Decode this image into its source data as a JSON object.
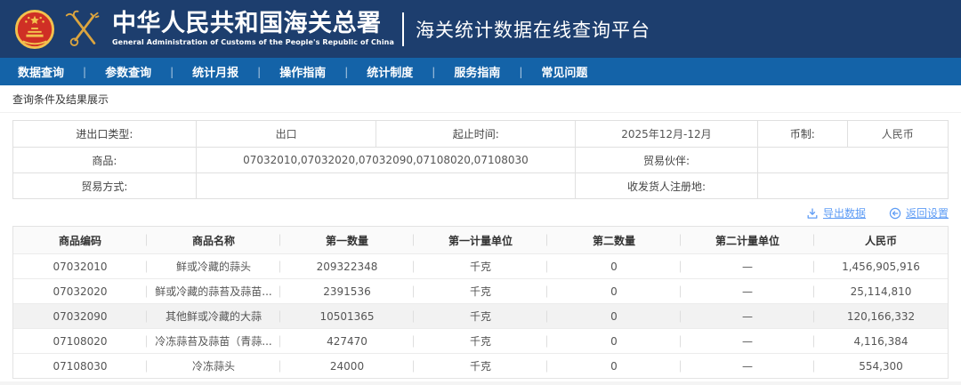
{
  "colors": {
    "header_bg": "#1d3e6e",
    "nav_bg": "#1463a8",
    "link_blue": "#5e9cf5",
    "row_highlight": "#f2f2f2",
    "emblem_gold": "#f3c14d",
    "logo_gold": "#dca53f"
  },
  "header": {
    "org_name": "中华人民共和国海关总署",
    "org_name_en": "General Administration of Customs of the People's Republic of China",
    "platform_title": "海关统计数据在线查询平台"
  },
  "nav": {
    "separator": "|",
    "items": [
      "数据查询",
      "参数查询",
      "统计月报",
      "操作指南",
      "统计制度",
      "服务指南",
      "常见问题"
    ]
  },
  "breadcrumb": "查询条件及结果展示",
  "conditions": {
    "row1": [
      "进出口类型:",
      "出口",
      "起止时间:",
      "2025年12月-12月",
      "币制:",
      "人民币"
    ],
    "row2": [
      "商品:",
      "07032010,07032020,07032090,07108020,07108030",
      "贸易伙伴:",
      ""
    ],
    "row3": [
      "贸易方式:",
      "",
      "收发货人注册地:",
      ""
    ]
  },
  "toolbar": {
    "export_label": "导出数据",
    "return_label": "返回设置"
  },
  "results": {
    "columns": [
      "商品编码",
      "商品名称",
      "第一数量",
      "第一计量单位",
      "第二数量",
      "第二计量单位",
      "人民币"
    ],
    "rows": [
      [
        "07032010",
        "鲜或冷藏的蒜头",
        "209322348",
        "千克",
        "0",
        "—",
        "1,456,905,916"
      ],
      [
        "07032020",
        "鲜或冷藏的蒜苔及蒜苗...",
        "2391536",
        "千克",
        "0",
        "—",
        "25,114,810"
      ],
      [
        "07032090",
        "其他鲜或冷藏的大蒜",
        "10501365",
        "千克",
        "0",
        "—",
        "120,166,332"
      ],
      [
        "07108020",
        "冷冻蒜苔及蒜苗（青蒜...",
        "427470",
        "千克",
        "0",
        "—",
        "4,116,384"
      ],
      [
        "07108030",
        "冷冻蒜头",
        "24000",
        "千克",
        "0",
        "—",
        "554,300"
      ]
    ]
  }
}
